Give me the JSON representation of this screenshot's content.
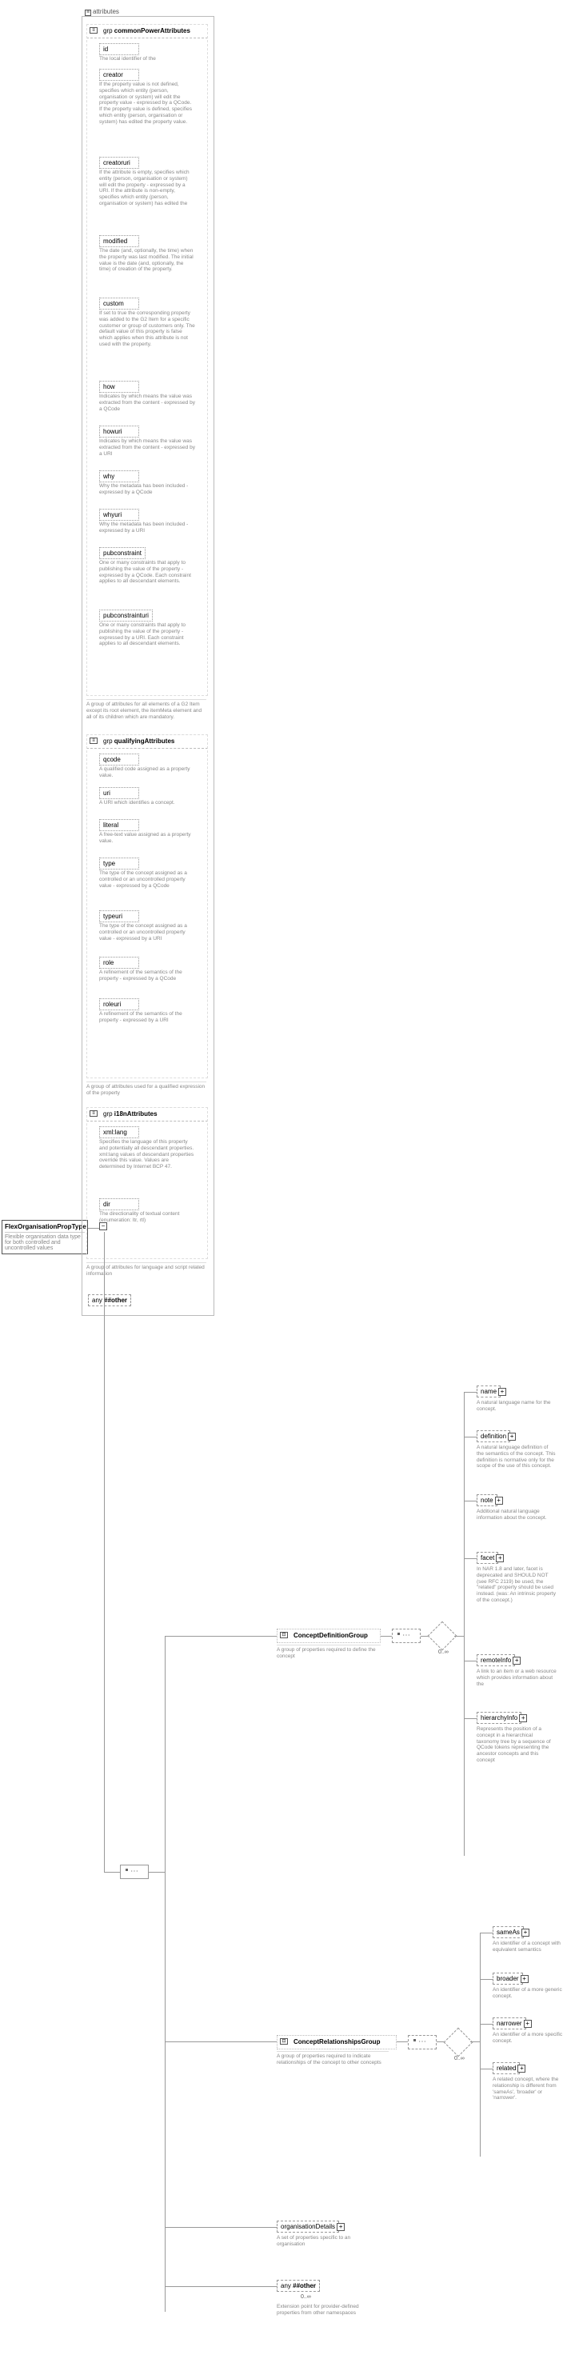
{
  "root": {
    "title": "FlexOrganisationPropType",
    "desc": "Flexible organisation data type for both controlled and uncontrolled values"
  },
  "attributes_label": "attributes",
  "grp1": {
    "label": "commonPowerAttributes",
    "desc": "A group of attributes for all elements of a G2 Item except its root element, the itemMeta element and all of its children which are mandatory."
  },
  "cpa": {
    "id": {
      "n": "id",
      "d": "The local identifier of the"
    },
    "creator": {
      "n": "creator",
      "d": "If the property value is not defined, specifies which entity (person, organisation or system) will edit the property value - expressed by a QCode. If the property value is defined, specifies which entity (person, organisation or system) has edited the property value."
    },
    "creatoruri": {
      "n": "creatoruri",
      "d": "If the attribute is empty, specifies which entity (person, organisation or system) will edit the property - expressed by a URI. If the attribute is non-empty, specifies which entity (person, organisation or system) has edited the"
    },
    "modified": {
      "n": "modified",
      "d": "The date (and, optionally, the time) when the property was last modified. The initial value is the date (and, optionally, the time) of creation of the property."
    },
    "custom": {
      "n": "custom",
      "d": "If set to true the corresponding property was added to the G2 Item for a specific customer or group of customers only. The default value of this property is false which applies when this attribute is not used with the property."
    },
    "how": {
      "n": "how",
      "d": "Indicates by which means the value was extracted from the content - expressed by a QCode"
    },
    "howuri": {
      "n": "howuri",
      "d": "Indicates by which means the value was extracted from the content - expressed by a URI"
    },
    "why": {
      "n": "why",
      "d": "Why the metadata has been included - expressed by a QCode"
    },
    "whyuri": {
      "n": "whyuri",
      "d": "Why the metadata has been included - expressed by a URI"
    },
    "pubconstraint": {
      "n": "pubconstraint",
      "d": "One or many constraints that apply to publishing the value of the property - expressed by a QCode. Each constraint applies to all descendant elements."
    },
    "pubconstrainturi": {
      "n": "pubconstrainturi",
      "d": "One or many constraints that apply to publishing the value of the property - expressed by a URI. Each constraint applies to all descendant elements."
    }
  },
  "grp2": {
    "label": "qualifyingAttributes",
    "desc": "A group of attributes used for a qualified expression of the property"
  },
  "qa": {
    "qcode": {
      "n": "qcode",
      "d": "A qualified code assigned as a property value."
    },
    "uri": {
      "n": "uri",
      "d": "A URI which identifies a concept."
    },
    "literal": {
      "n": "literal",
      "d": "A free-text value assigned as a property value."
    },
    "type": {
      "n": "type",
      "d": "The type of the concept assigned as a controlled or an uncontrolled property value - expressed by a QCode"
    },
    "typeuri": {
      "n": "typeuri",
      "d": "The type of the concept assigned as a controlled or an uncontrolled property value - expressed by a URI"
    },
    "role": {
      "n": "role",
      "d": "A refinement of the semantics of the property - expressed by a QCode"
    },
    "roleuri": {
      "n": "roleuri",
      "d": "A refinement of the semantics of the property - expressed by a URI"
    }
  },
  "grp3": {
    "label": "i18nAttributes",
    "desc": "A group of attributes for language and script related information"
  },
  "i18n": {
    "xmllang": {
      "n": "xml:lang",
      "d": "Specifies the language of this property and potentially all descendant properties. xml:lang values of descendant properties override this value. Values are determined by Internet BCP 47."
    },
    "dir": {
      "n": "dir",
      "d": "The directionality of textual content (enumeration: ltr, rtl)"
    }
  },
  "any_attr": "##other",
  "cdg": {
    "label": "ConceptDefinitionGroup",
    "desc": "A group of properties required to define the concept"
  },
  "cdg_items": {
    "name": {
      "n": "name",
      "d": "A natural language name for the concept."
    },
    "definition": {
      "n": "definition",
      "d": "A natural language definition of the semantics of the concept. This definition is normative only for the scope of the use of this concept."
    },
    "note": {
      "n": "note",
      "d": "Additional natural language information about the concept."
    },
    "facet": {
      "n": "facet",
      "d": "In NAR 1.8 and later, facet is deprecated and SHOULD NOT (see RFC 2119) be used, the \"related\" property should be used instead. (was: An intrinsic property of the concept.)"
    },
    "remoteInfo": {
      "n": "remoteInfo",
      "d": "A link to an item or a web resource which provides information about the"
    },
    "hierarchyInfo": {
      "n": "hierarchyInfo",
      "d": "Represents the position of a concept in a hierarchical taxonomy tree by a sequence of QCode tokens representing the ancestor concepts and this concept"
    }
  },
  "crg": {
    "label": "ConceptRelationshipsGroup",
    "desc": "A group of properties required to indicate relationships of the concept to other concepts"
  },
  "crg_items": {
    "sameAs": {
      "n": "sameAs",
      "d": "An identifier of a concept with equivalent semantics"
    },
    "broader": {
      "n": "broader",
      "d": "An identifier of a more generic concept."
    },
    "narrower": {
      "n": "narrower",
      "d": "An identifier of a more specific concept."
    },
    "related": {
      "n": "related",
      "d": "A related concept, where the relationship is different from 'sameAs', 'broader' or 'narrower'."
    }
  },
  "orgDetails": {
    "n": "organisationDetails",
    "d": "A set of properties specific to an organisation"
  },
  "anyOther": {
    "n": "##other",
    "d": "Extension point for provider-defined properties from other namespaces"
  },
  "any_label": "any",
  "grp_label": "grp",
  "multi": "0..∞"
}
